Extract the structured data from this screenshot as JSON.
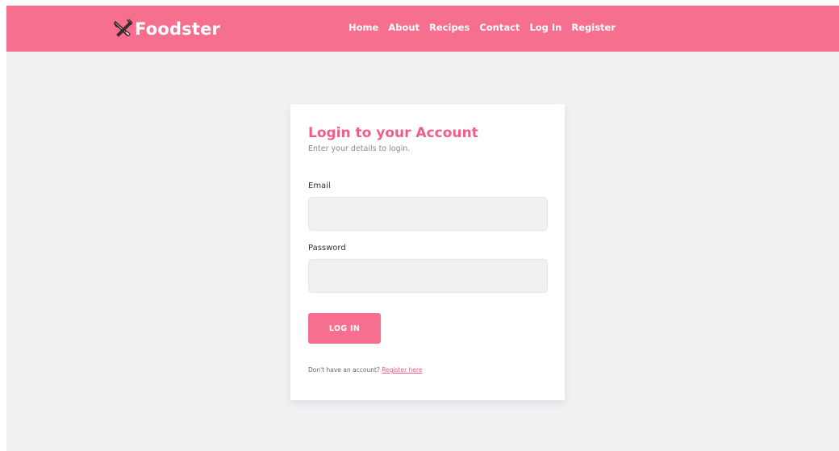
{
  "navbar": {
    "brand_name": "Foodster",
    "brand_icon": "utensils-icon",
    "links": [
      {
        "label": "Home"
      },
      {
        "label": "About"
      },
      {
        "label": "Recipes"
      },
      {
        "label": "Contact"
      },
      {
        "label": "Log In"
      },
      {
        "label": "Register"
      }
    ]
  },
  "login_card": {
    "title": "Login to your Account",
    "subtitle": "Enter your details to login.",
    "email_label": "Email",
    "email_value": "",
    "password_label": "Password",
    "password_value": "",
    "submit_label": "LOG IN",
    "register_prompt": "Don't have an account?",
    "register_link": "Register here"
  },
  "colors": {
    "brand_pink": "#f76f8e",
    "title_pink": "#ee5f86",
    "page_background": "#f2f0f3",
    "input_background": "#f2f0f2"
  }
}
